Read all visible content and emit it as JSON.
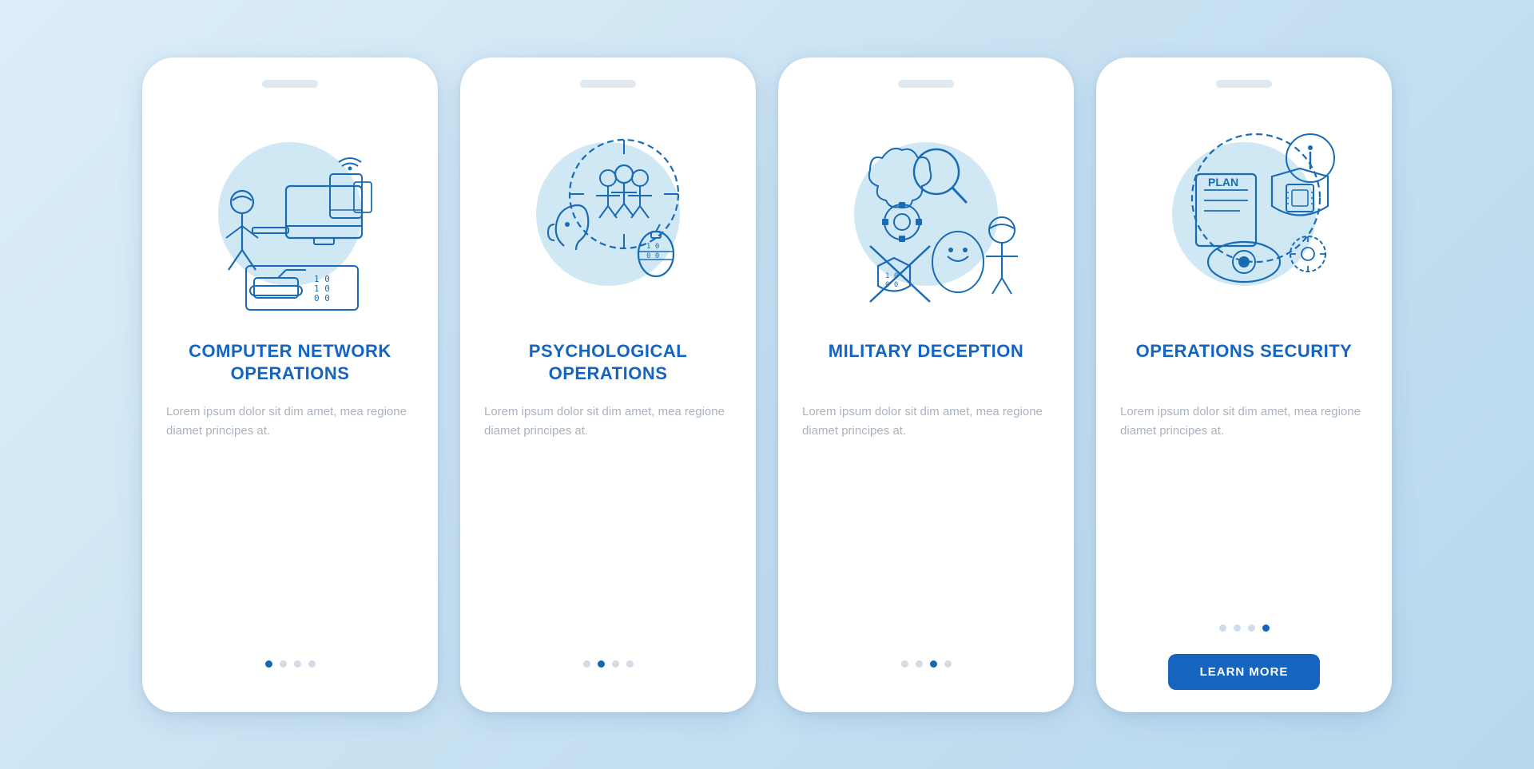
{
  "cards": [
    {
      "id": "computer-network",
      "title": "COMPUTER NETWORK OPERATIONS",
      "description": "Lorem ipsum dolor sit dim amet, mea regione diamet principes at.",
      "dots": [
        true,
        false,
        false,
        false
      ],
      "showButton": false,
      "buttonLabel": ""
    },
    {
      "id": "psychological",
      "title": "PSYCHOLOGICAL OPERATIONS",
      "description": "Lorem ipsum dolor sit dim amet, mea regione diamet principes at.",
      "dots": [
        false,
        true,
        false,
        false
      ],
      "showButton": false,
      "buttonLabel": ""
    },
    {
      "id": "military-deception",
      "title": "MILITARY DECEPTION",
      "description": "Lorem ipsum dolor sit dim amet, mea regione diamet principes at.",
      "dots": [
        false,
        false,
        true,
        false
      ],
      "showButton": false,
      "buttonLabel": ""
    },
    {
      "id": "operations-security",
      "title": "OPERATIONS SECURITY",
      "description": "Lorem ipsum dolor sit dim amet, mea regione diamet principes at.",
      "dots": [
        false,
        false,
        false,
        true
      ],
      "showButton": true,
      "buttonLabel": "LEARN MORE"
    }
  ]
}
